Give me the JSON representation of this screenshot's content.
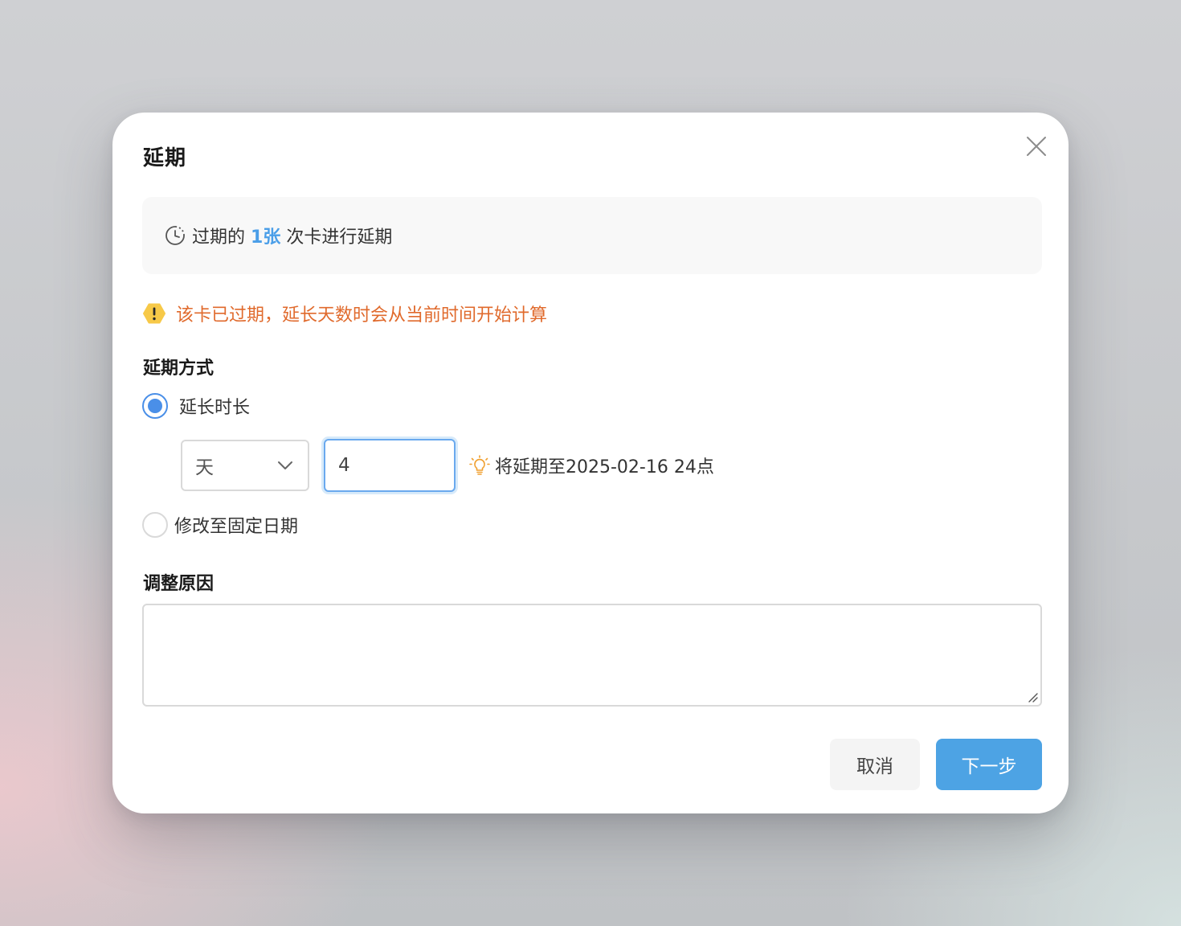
{
  "dialog": {
    "title": "延期",
    "info": {
      "prefix": "过期的",
      "count": "1张",
      "suffix": "次卡进行延期",
      "icon": "clock-icon"
    },
    "warning": {
      "text": "该卡已过期，延长天数时会从当前时间开始计算",
      "icon": "warning-icon"
    },
    "method": {
      "label": "延期方式",
      "options": [
        {
          "label": "延长时长",
          "checked": true
        },
        {
          "label": "修改至固定日期",
          "checked": false
        }
      ],
      "unit": {
        "value": "天",
        "options": [
          "天"
        ]
      },
      "amount": {
        "value": "4"
      },
      "hint": {
        "text": "将延期至2025-02-16 24点",
        "icon": "lightbulb-icon"
      }
    },
    "reason": {
      "label": "调整原因",
      "value": "",
      "placeholder": ""
    },
    "buttons": {
      "cancel": "取消",
      "next": "下一步"
    }
  },
  "colors": {
    "accent": "#4a8fe8",
    "primary_button": "#4da3e4",
    "highlight_count": "#4a9ee8",
    "warning_text": "#e06a2c",
    "warning_badge": "#f7c948",
    "hint_bulb": "#f0a030"
  }
}
